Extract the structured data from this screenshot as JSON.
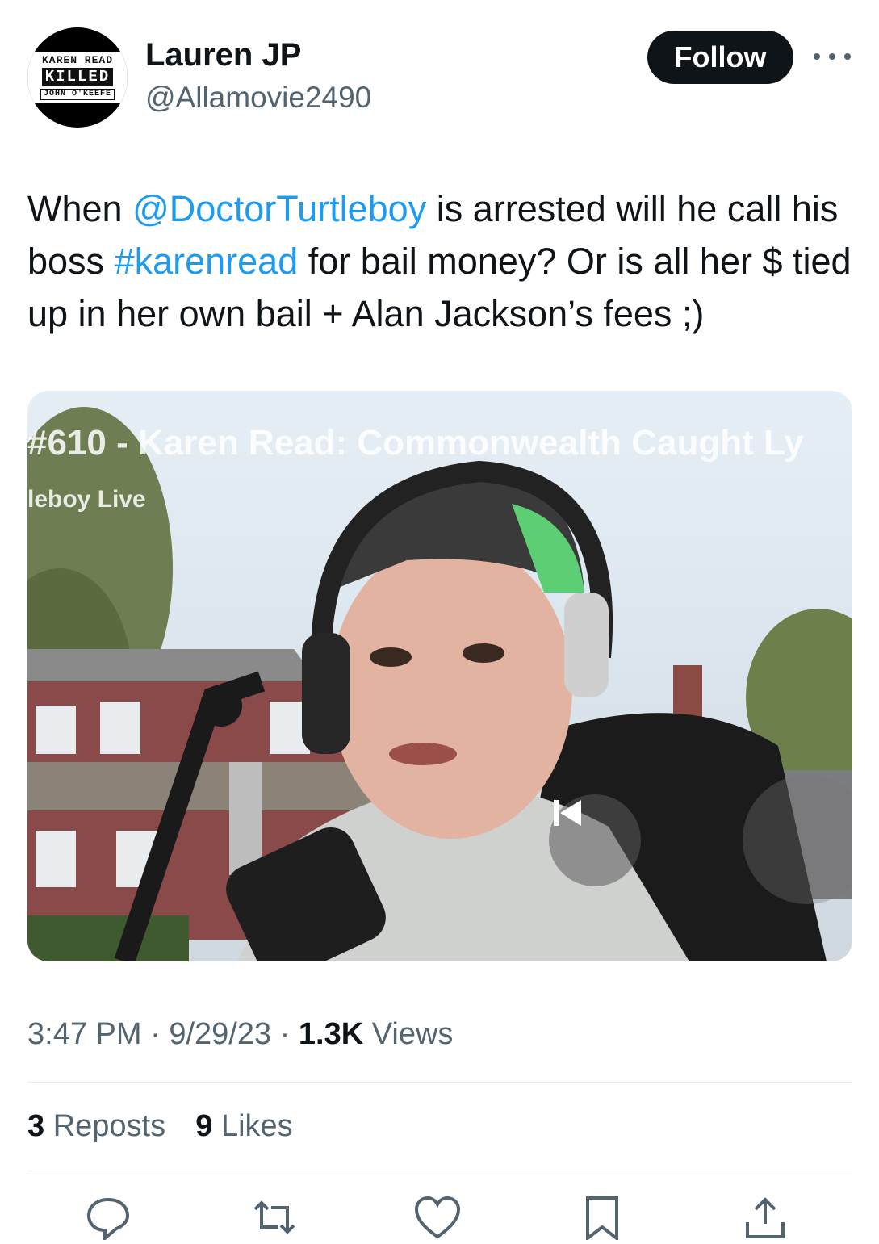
{
  "user": {
    "name": "Lauren JP",
    "handle": "@Allamovie2490",
    "avatar_text": [
      "KAREN READ",
      "KILLED",
      "JOHN O'KEEFE"
    ]
  },
  "follow_label": "Follow",
  "tweet": {
    "text_1": "When ",
    "mention": "@DoctorTurtleboy",
    "text_2": " is arrested will he call his boss ",
    "hashtag": "#karenread",
    "text_3": " for bail money? Or is all her $ tied up in her own bail + Alan Jackson’s fees ;)"
  },
  "media": {
    "video_title": "#610 - Karen Read: Commonwealth Caught Ly",
    "video_subtitle": "leboy Live"
  },
  "meta": {
    "time": "3:47 PM",
    "date": "9/29/23",
    "views_count": "1.3K",
    "views_label": "Views"
  },
  "stats": {
    "reposts_count": "3",
    "reposts_label": "Reposts",
    "likes_count": "9",
    "likes_label": "Likes"
  },
  "colors": {
    "link": "#1d9bf0",
    "text": "#0f1419",
    "secondary": "#536471"
  }
}
